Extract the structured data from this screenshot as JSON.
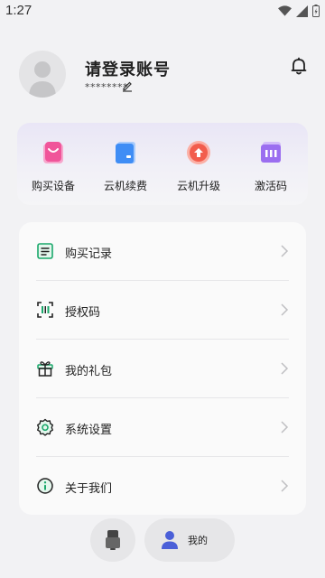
{
  "status_bar": {
    "time": "1:27"
  },
  "profile": {
    "username": "请登录账号",
    "masked_account": "********"
  },
  "quick_actions": [
    {
      "label": "购买设备",
      "icon": "shopping-bag-icon",
      "color": "#f0559a"
    },
    {
      "label": "云机续费",
      "icon": "wallet-card-icon",
      "color": "#3f8df5"
    },
    {
      "label": "云机升级",
      "icon": "upgrade-arrow-icon",
      "color": "#f25d4d"
    },
    {
      "label": "激活码",
      "icon": "activation-code-icon",
      "color": "#9b6ef0"
    }
  ],
  "menu": [
    {
      "label": "购买记录",
      "icon": "purchase-record-icon"
    },
    {
      "label": "授权码",
      "icon": "scan-code-icon"
    },
    {
      "label": "我的礼包",
      "icon": "gift-icon"
    },
    {
      "label": "系统设置",
      "icon": "settings-gear-icon"
    },
    {
      "label": "关于我们",
      "icon": "info-icon"
    }
  ],
  "bottom_nav": {
    "device_icon": "cloud-phone-icon",
    "mine_label": "我的",
    "mine_icon": "user-profile-icon",
    "accent_color": "#4a5fd8"
  },
  "colors": {
    "background": "#f2f2f4",
    "card": "#fafafa",
    "menu_icon_green": "#1aa86b"
  }
}
